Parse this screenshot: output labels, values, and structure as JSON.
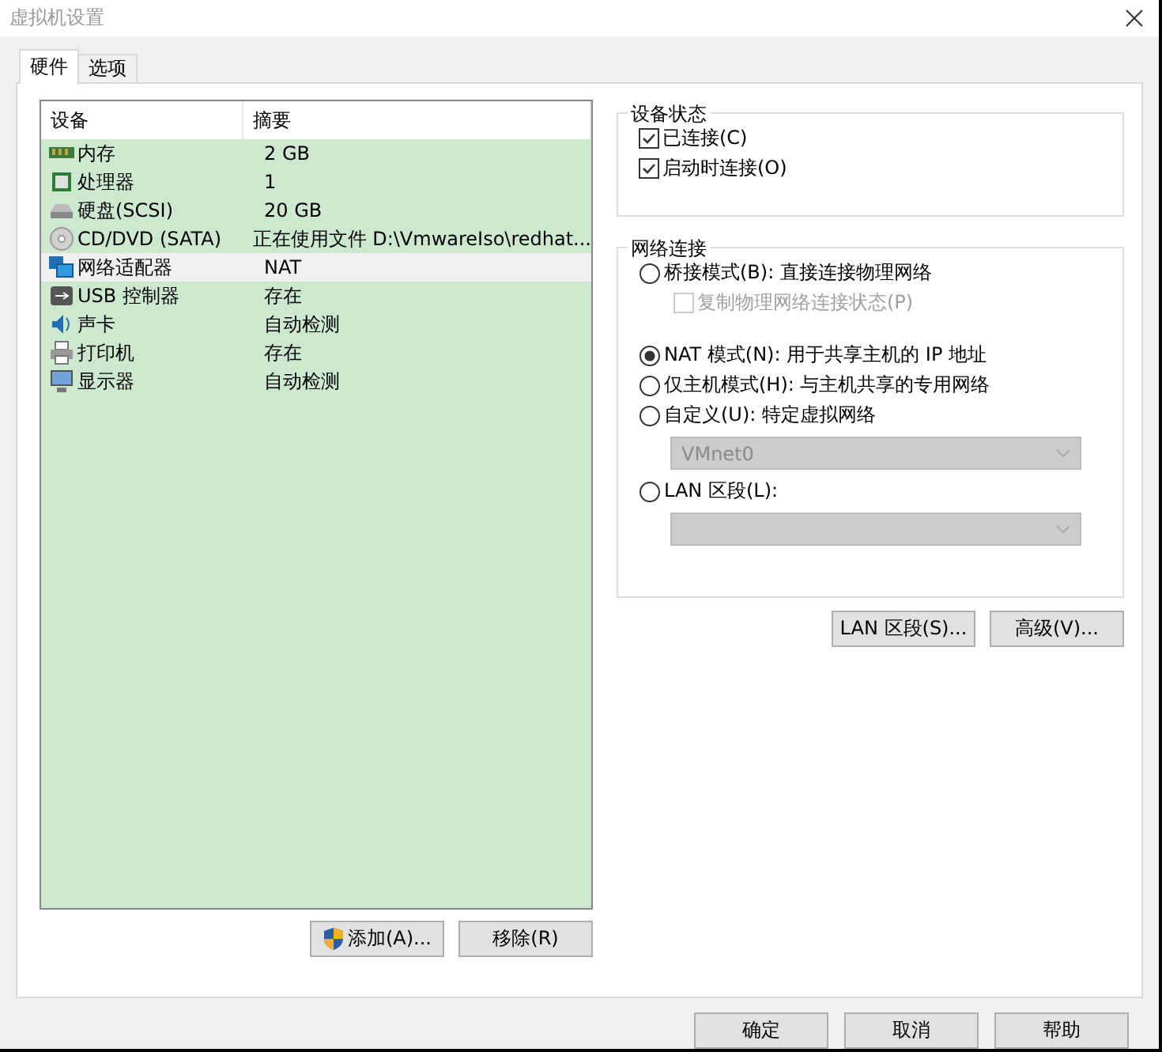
{
  "window": {
    "title": "虚拟机设置"
  },
  "tabs": [
    {
      "label": "硬件",
      "selected": true
    },
    {
      "label": "选项",
      "selected": false
    }
  ],
  "device_table": {
    "columns": [
      "设备",
      "摘要"
    ],
    "rows": [
      {
        "device": "内存",
        "summary": "2 GB",
        "selected": false
      },
      {
        "device": "处理器",
        "summary": "1",
        "selected": false
      },
      {
        "device": "硬盘(SCSI)",
        "summary": "20 GB",
        "selected": false
      },
      {
        "device": "CD/DVD (SATA)",
        "summary": "正在使用文件 D:\\VmwareIso\\redhat...",
        "selected": false
      },
      {
        "device": "网络适配器",
        "summary": "NAT",
        "selected": true
      },
      {
        "device": "USB 控制器",
        "summary": "存在",
        "selected": false
      },
      {
        "device": "声卡",
        "summary": "自动检测",
        "selected": false
      },
      {
        "device": "打印机",
        "summary": "存在",
        "selected": false
      },
      {
        "device": "显示器",
        "summary": "自动检测",
        "selected": false
      }
    ]
  },
  "list_buttons": [
    "添加(A)...",
    "移除(R)"
  ],
  "device_status": {
    "title": "设备状态",
    "options": [
      {
        "label": "已连接(C)",
        "checked": true
      },
      {
        "label": "启动时连接(O)",
        "checked": true
      }
    ]
  },
  "network": {
    "title": "网络连接",
    "options": [
      {
        "kind": "radio",
        "label": "桥接模式(B): 直接连接物理网络",
        "selected": false
      },
      {
        "kind": "checkbox",
        "label": "复制物理网络连接状态(P)",
        "checked": false,
        "disabled": true
      },
      {
        "kind": "radio",
        "label": "NAT 模式(N): 用于共享主机的 IP 地址",
        "selected": true
      },
      {
        "kind": "radio",
        "label": "仅主机模式(H): 与主机共享的专用网络",
        "selected": false
      },
      {
        "kind": "radio",
        "label": "自定义(U): 特定虚拟网络",
        "selected": false
      },
      {
        "kind": "select",
        "value": "VMnet0",
        "disabled": true
      },
      {
        "kind": "radio",
        "label": "LAN 区段(L):",
        "selected": false
      },
      {
        "kind": "select",
        "disabled": true
      }
    ]
  },
  "network_buttons": [
    "LAN 区段(S)...",
    "高级(V)..."
  ],
  "dialog_buttons": [
    "确定",
    "取消",
    "帮助"
  ]
}
